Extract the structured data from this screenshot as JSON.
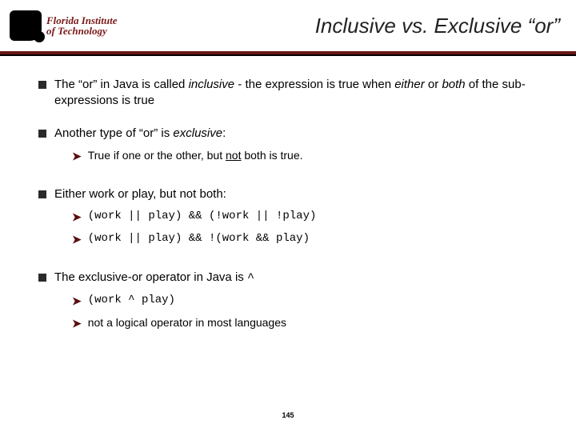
{
  "logo": {
    "line1": "Florida Institute",
    "line2": "of Technology"
  },
  "title": "Inclusive vs. Exclusive “or”",
  "bullets": [
    {
      "pre": "The “or” in Java is called ",
      "em1": "inclusive",
      "mid": " - the expression is true when ",
      "em2": "either",
      "mid2": " or ",
      "em3": "both",
      "post": " of the sub-expressions is true"
    },
    {
      "text_a": "Another type of “or” is ",
      "em": "exclusive",
      "text_b": ":",
      "subs": [
        {
          "pre": "True if one or the other, but ",
          "u": "not",
          "post": " both is true."
        }
      ]
    },
    {
      "text": "Either work or play, but not both:",
      "subs": [
        {
          "code": "(work || play) && (!work || !play)"
        },
        {
          "code": "(work || play) && !(work && play)"
        }
      ]
    },
    {
      "pre": "The exclusive-or operator in Java is  ",
      "code": "^",
      "subs": [
        {
          "code": "(work ^ play)"
        },
        {
          "text": "not a logical operator in most languages"
        }
      ]
    }
  ],
  "page": "145"
}
